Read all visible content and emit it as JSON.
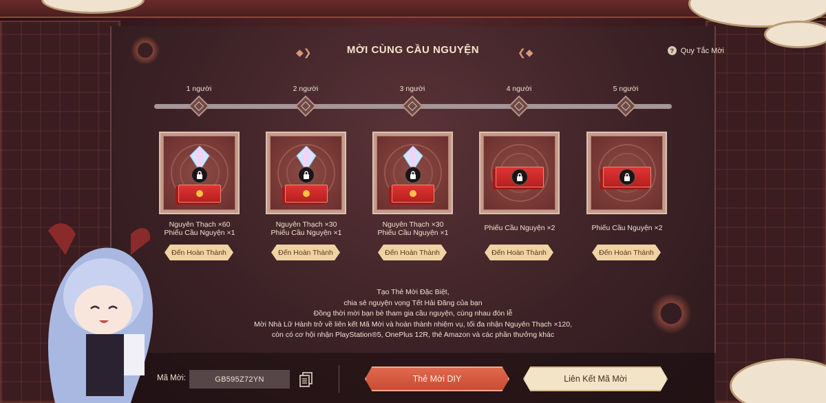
{
  "header": {
    "title": "MỜI CÙNG CẦU NGUYỆN",
    "rules_label": "Quy Tắc Mời",
    "rules_icon_glyph": "?"
  },
  "milestones": [
    {
      "label": "1 người",
      "reward_line1": "Nguyên Thạch ×60",
      "reward_line2": "Phiếu Cầu Nguyện ×1",
      "has_gem": true,
      "button": "Đến Hoàn Thành"
    },
    {
      "label": "2 người",
      "reward_line1": "Nguyên Thạch ×30",
      "reward_line2": "Phiếu Cầu Nguyện ×1",
      "has_gem": true,
      "button": "Đến Hoàn Thành"
    },
    {
      "label": "3 người",
      "reward_line1": "Nguyên Thạch ×30",
      "reward_line2": "Phiếu Cầu Nguyện ×1",
      "has_gem": true,
      "button": "Đến Hoàn Thành"
    },
    {
      "label": "4 người",
      "reward_line1": "Phiếu Cầu Nguyện ×2",
      "reward_line2": "",
      "has_gem": false,
      "button": "Đến Hoàn Thành"
    },
    {
      "label": "5 người",
      "reward_line1": "Phiếu Cầu Nguyện ×2",
      "reward_line2": "",
      "has_gem": false,
      "button": "Đến Hoàn Thành"
    }
  ],
  "description": [
    "Tạo Thẻ Mời Đặc Biệt,",
    "chia sẻ nguyện vọng Tết Hải Đăng của bạn",
    "Đồng thời mời bạn bè tham gia cầu nguyện, cùng nhau đón lễ",
    "Mời Nhà Lữ Hành trở về liên kết Mã Mời và hoàn thành nhiệm vụ, tối đa nhận Nguyên Thạch ×120,",
    "còn có cơ hội nhận PlayStation®5, OnePlus 12R, thẻ Amazon và các phần thưởng khác"
  ],
  "footer": {
    "code_label": "Mã Mời:",
    "code_value": "GB595Z72YN",
    "diy_button": "Thẻ Mời DIY",
    "link_button": "Liên Kết Mã Mời"
  },
  "colors": {
    "accent_button": "#c94a34",
    "secondary_button": "#f3e4c8",
    "goto_button": "#f0d3a2"
  }
}
